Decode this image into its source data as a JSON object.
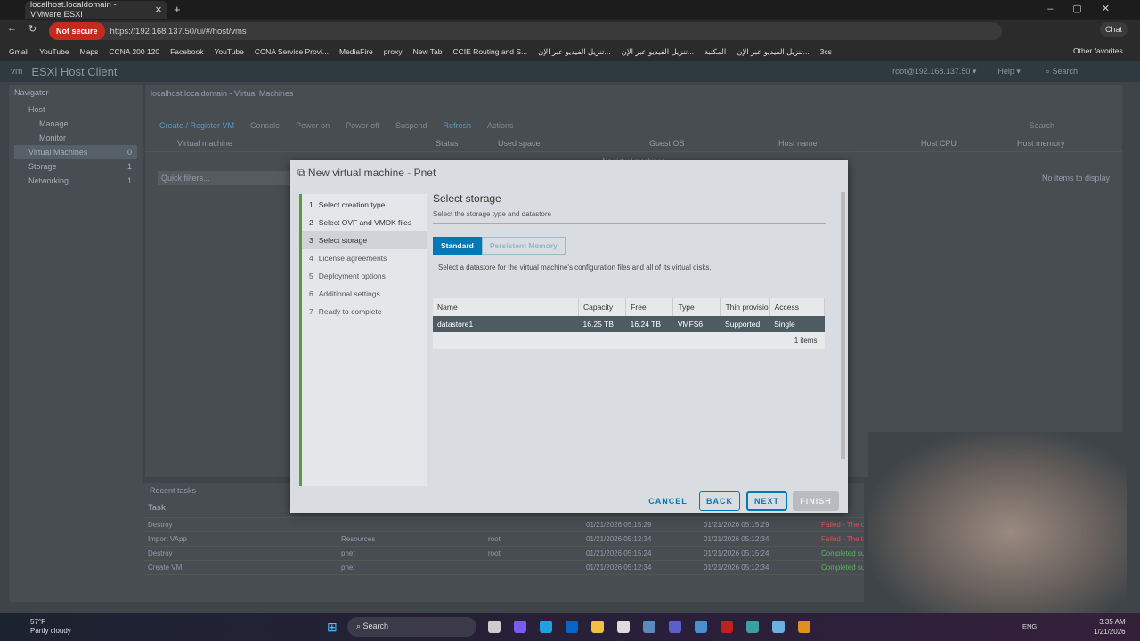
{
  "browser": {
    "tab_title": "localhost.localdomain - VMware ESXi",
    "new_tab": "+",
    "security": "Not secure",
    "url": "https://192.168.137.50/ui/#/host/vms",
    "chat": "Chat",
    "bookmarks": [
      "Gmail",
      "YouTube",
      "Maps",
      "CCNA 200 120",
      "Facebook",
      "YouTube",
      "CCNA Service Provi...",
      "MediaFire",
      "proxy",
      "New Tab",
      "CCIE Routing and S...",
      "تنزيل الفيديو عبر الإن...",
      "تنزيل الفيديو عبر الإن...",
      "المكتبة",
      "تنزيل الفيديو عبر الإن...",
      "3cs"
    ],
    "other_favorites": "Other favorites"
  },
  "app": {
    "logo": "vm",
    "title": "ESXi Host Client",
    "user": "root@192.168.137.50 ▾",
    "help": "Help ▾",
    "search": "Search"
  },
  "navigator": {
    "title": "Navigator",
    "items": [
      {
        "label": "Host"
      },
      {
        "label": "Manage"
      },
      {
        "label": "Monitor"
      },
      {
        "label": "Virtual Machines",
        "count": "0"
      },
      {
        "label": "Storage",
        "count": "1"
      },
      {
        "label": "Networking",
        "count": "1"
      }
    ]
  },
  "main": {
    "breadcrumb": "localhost.localdomain - Virtual Machines",
    "toolbar": [
      "Create / Register VM",
      "Console",
      "Power on",
      "Power off",
      "Suspend",
      "Refresh",
      "Actions"
    ],
    "search": "Search",
    "columns": [
      "Virtual machine",
      "Status",
      "Used space",
      "Guest OS",
      "Host name",
      "Host CPU",
      "Host memory"
    ],
    "empty": "No virtual machines",
    "quick_filters": "Quick filters...",
    "no_items": "No items to display"
  },
  "tasks": {
    "title": "Recent tasks",
    "column": "Task",
    "rows": [
      {
        "task": "Destroy",
        "target": "",
        "initiator": "",
        "queued": "01/21/2026 05:15:29",
        "started": "01/21/2026 05:15:29",
        "result": "Failed - The object 'vim.VirtualMa...",
        "status": "failed"
      },
      {
        "task": "Import VApp",
        "target": "Resources",
        "initiator": "root",
        "queued": "01/21/2026 05:12:34",
        "started": "01/21/2026 05:12:34",
        "result": "Failed - The task was cancelled by...",
        "status": "failed"
      },
      {
        "task": "Destroy",
        "target": "pnet",
        "initiator": "root",
        "queued": "01/21/2026 05:15:24",
        "started": "01/21/2026 05:15:24",
        "result": "Completed successfully",
        "status": "ok"
      },
      {
        "task": "Create VM",
        "target": "pnet",
        "initiator": "",
        "queued": "01/21/2026 05:12:34",
        "started": "01/21/2026 05:12:34",
        "result": "Completed successfully",
        "status": "ok"
      }
    ]
  },
  "dialog": {
    "title": "New virtual machine - Pnet",
    "steps": [
      {
        "n": "1",
        "label": "Select creation type"
      },
      {
        "n": "2",
        "label": "Select OVF and VMDK files"
      },
      {
        "n": "3",
        "label": "Select storage"
      },
      {
        "n": "4",
        "label": "License agreements"
      },
      {
        "n": "5",
        "label": "Deployment options"
      },
      {
        "n": "6",
        "label": "Additional settings"
      },
      {
        "n": "7",
        "label": "Ready to complete"
      }
    ],
    "heading": "Select storage",
    "subheading": "Select the storage type and datastore",
    "segments": [
      "Standard",
      "Persistent Memory"
    ],
    "description": "Select a datastore for the virtual machine's configuration files and all of its virtual disks.",
    "columns": [
      "Name",
      "Capacity",
      "Free",
      "Type",
      "Thin provisioning",
      "Access"
    ],
    "rows": [
      {
        "name": "datastore1",
        "capacity": "16.25 TB",
        "free": "16.24 TB",
        "type": "VMFS6",
        "thin": "Supported",
        "access": "Single"
      }
    ],
    "count": "1 items",
    "buttons": {
      "cancel": "CANCEL",
      "back": "BACK",
      "next": "NEXT",
      "finish": "FINISH"
    }
  },
  "taskbar": {
    "temp": "57°F",
    "weather": "Partly cloudy",
    "search": "Search",
    "lang": "ENG",
    "time": "3:35 AM",
    "date": "1/21/2026"
  }
}
